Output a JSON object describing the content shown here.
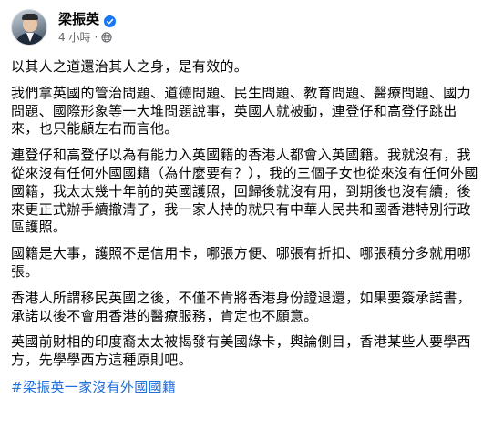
{
  "author": {
    "name": "梁振英",
    "verified_icon": "verified-badge-icon",
    "verified_color": "#1877f2"
  },
  "meta": {
    "time": "4 小時",
    "dot": "·",
    "privacy_icon": "globe-icon"
  },
  "menu": {
    "icon": "more-horizontal-icon",
    "label": "···"
  },
  "post": {
    "paragraphs": [
      "以其人之道還治其人之身，是有效的。",
      "我們拿英國的管治問題、道德問題、民生問題、教育問題、醫療問題、國力問題、國際形象等一大堆問題說事，英國人就被動，連登仔和高登仔跳出來，也只能顧左右而言他。",
      "連登仔和高登仔以為有能力入英國籍的香港人都會入英國籍。我就沒有，我從來沒有任何外國國籍（為什麼要有？），我的三個子女也從來沒有任何外國國籍，我太太幾十年前的英國護照，回歸後就沒有用，到期後也沒有續，後來更正式辦手續撤清了，我一家人持的就只有中華人民共和國香港特別行政區護照。",
      "國籍是大事，護照不是信用卡，哪張方便、哪張有折扣、哪張積分多就用哪張。",
      "香港人所謂移民英國之後，不僅不肯將香港身份證退還，如果要簽承諾書，承諾以後不會用香港的醫療服務，肯定也不願意。",
      "英國前財相的印度裔太太被揭發有美國綠卡，輿論側目，香港某些人要學西方，先學學西方這種原則吧。"
    ],
    "hashtag": "#梁振英一家沒有外國國籍"
  },
  "colors": {
    "text": "#050505",
    "secondary": "#65676b",
    "link": "#216fdb"
  }
}
